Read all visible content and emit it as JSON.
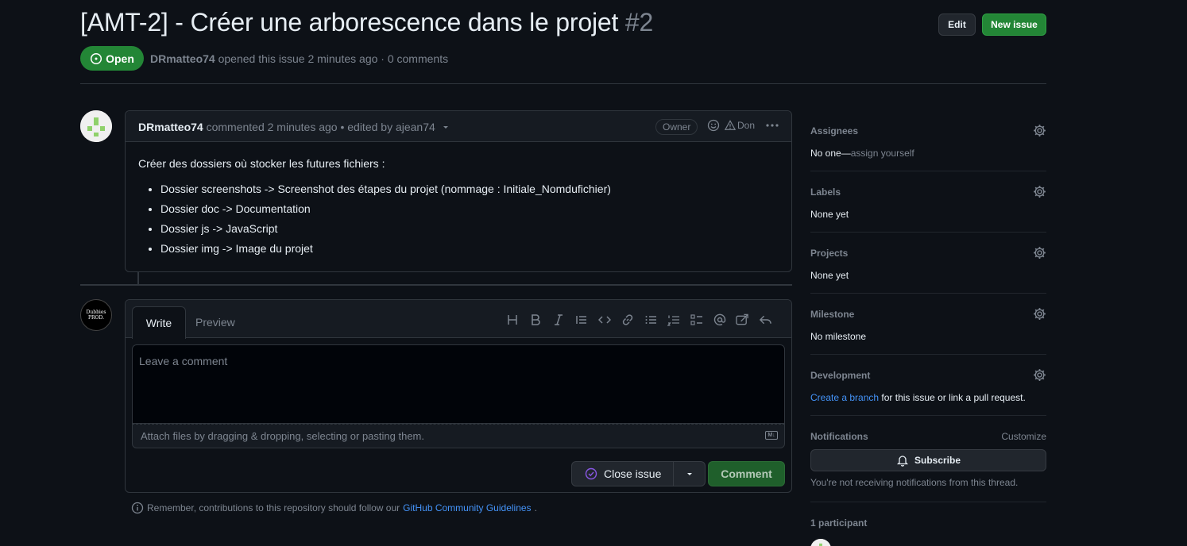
{
  "issue": {
    "title": "[AMT-2] - Créer une arborescence dans le projet",
    "number": "#2",
    "state": "Open",
    "author": "DRmatteo74",
    "opened_text": "opened this issue 2 minutes ago · 0 comments"
  },
  "header": {
    "edit_label": "Edit",
    "new_issue_label": "New issue"
  },
  "comment": {
    "author": "DRmatteo74",
    "meta": "commented 2 minutes ago • edited by ajean74",
    "badge": "Owner",
    "reaction_label": "Don",
    "intro": "Créer des dossiers où stocker les futures fichiers :",
    "items": [
      "Dossier screenshots -> Screenshot des étapes du projet (nommage : Initiale_Nomdufichier)",
      "Dossier doc -> Documentation",
      "Dossier js -> JavaScript",
      "Dossier img -> Image du projet"
    ]
  },
  "form": {
    "tab_write": "Write",
    "tab_preview": "Preview",
    "placeholder": "Leave a comment",
    "attach_text": "Attach files by dragging & dropping, selecting or pasting them.",
    "md_badge": "M↓",
    "close_label": "Close issue",
    "comment_label": "Comment",
    "guidelines_prefix": "Remember, contributions to this repository should follow our",
    "guidelines_link": "GitHub Community Guidelines",
    "avatar_text_1": "Dubbies",
    "avatar_text_2": "PROD."
  },
  "sidebar": {
    "assignees_title": "Assignees",
    "assignees_value": "No one—",
    "assignees_link": "assign yourself",
    "labels_title": "Labels",
    "labels_value": "None yet",
    "projects_title": "Projects",
    "projects_value": "None yet",
    "milestone_title": "Milestone",
    "milestone_value": "No milestone",
    "development_title": "Development",
    "development_link": "Create a branch",
    "development_rest": " for this issue or link a pull request.",
    "notifications_title": "Notifications",
    "customize": "Customize",
    "subscribe": "Subscribe",
    "not_receiving": "You're not receiving notifications from this thread.",
    "participants": "1 participant"
  },
  "colors": {
    "accent_green": "#238636",
    "link_blue": "#4493f8",
    "bg": "#0d1117"
  }
}
